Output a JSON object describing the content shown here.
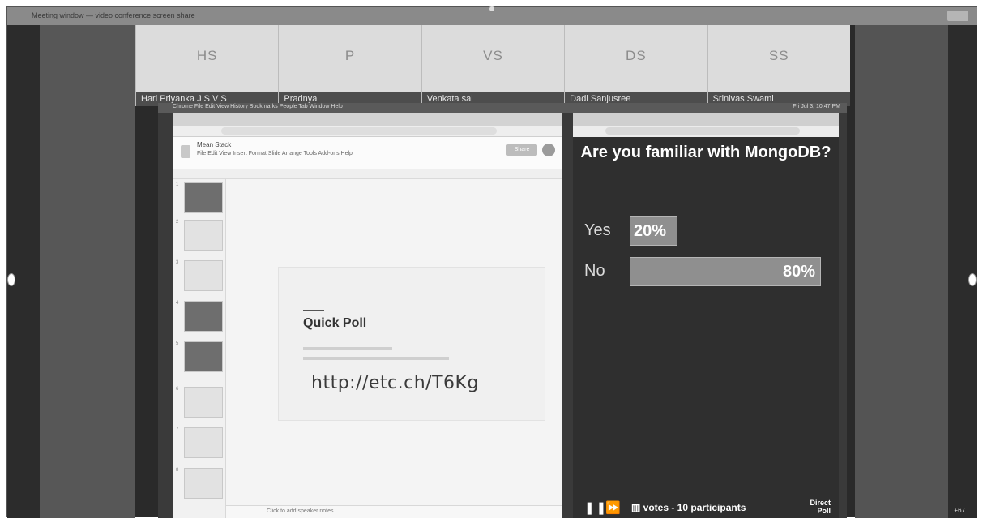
{
  "window": {
    "title_text": "Meeting window — video conference screen share"
  },
  "participants": [
    {
      "initials": "HS",
      "name": "Hari Priyanka J S V S"
    },
    {
      "initials": "P",
      "name": "Pradnya"
    },
    {
      "initials": "VS",
      "name": "Venkata sai"
    },
    {
      "initials": "DS",
      "name": "Dadi Sanjusree"
    },
    {
      "initials": "SS",
      "name": "Srinivas Swami"
    }
  ],
  "shared_screen": {
    "mac_menu": "Chrome  File  Edit  View  History  Bookmarks  People  Tab  Window  Help",
    "mac_status": "Fri Jul 3, 10:47 PM",
    "slides": {
      "doc_title": "Mean Stack",
      "doc_menu": "File  Edit  View  Insert  Format  Slide  Arrange  Tools  Add-ons  Help",
      "share_label": "Share",
      "slide_title": "Quick Poll",
      "poll_url": "http://etc.ch/T6Kg",
      "notes_placeholder": "Click to add speaker notes"
    },
    "poll": {
      "question": "Are you familiar with MongoDB?",
      "options": [
        {
          "label": "Yes",
          "percent": 20,
          "percent_text": "20%"
        },
        {
          "label": "No",
          "percent": 80,
          "percent_text": "80%"
        }
      ],
      "footer_text": "votes - 10 participants",
      "brand_line1": "Direct",
      "brand_line2": "Poll"
    }
  },
  "overflow_badge": "+67",
  "colors": {
    "frame": "#2a2a2a",
    "tile_bg": "#dcdcdc",
    "name_bar": "#4d4d4d",
    "poll_bg": "#2f2f2f",
    "bar": "#8f8f8f"
  },
  "icons": [
    "pause-icon",
    "fast-forward-icon",
    "chart-icon"
  ]
}
